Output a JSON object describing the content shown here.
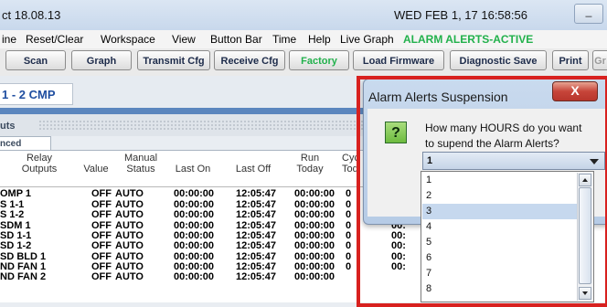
{
  "title_bar": {
    "left_text": "ct 18.08.13",
    "datetime": "WED FEB 1, 17  16:58:56",
    "min_button": "_"
  },
  "menu": {
    "items": [
      "ine",
      "Reset/Clear",
      "Workspace",
      "View",
      "Button Bar",
      "Time",
      "Help",
      "Live Graph"
    ],
    "alarm_status": "ALARM ALERTS-ACTIVE"
  },
  "toolbar": {
    "buttons": [
      "Scan",
      "Graph",
      "Transmit Cfg",
      "Receive Cfg",
      "Factory",
      "Load Firmware",
      "Diagnostic Save",
      "Print",
      "Gr"
    ]
  },
  "tab": {
    "label": "1 - 2 CMP"
  },
  "section": {
    "label": "uts"
  },
  "subtab": {
    "label": "nced"
  },
  "table": {
    "headers": {
      "relay_outputs": "Relay\nOutputs",
      "value": "Value",
      "manual_status": "Manual\nStatus",
      "last_on": "Last On",
      "last_off": "Last Off",
      "run_today": "Run\nToday",
      "cycles_today": "Cyc\nTod"
    },
    "rows": [
      {
        "name": "OMP 1",
        "value": "OFF",
        "status": "AUTO",
        "last_on": "00:00:00",
        "last_off": "12:05:47",
        "run_today": "00:00:00",
        "cycles": "0",
        "extra": ""
      },
      {
        "name": "S 1-1",
        "value": "OFF",
        "status": "AUTO",
        "last_on": "00:00:00",
        "last_off": "12:05:47",
        "run_today": "00:00:00",
        "cycles": "0",
        "extra": ""
      },
      {
        "name": "S 1-2",
        "value": "OFF",
        "status": "AUTO",
        "last_on": "00:00:00",
        "last_off": "12:05:47",
        "run_today": "00:00:00",
        "cycles": "0",
        "extra": ""
      },
      {
        "name": "SDM 1",
        "value": "OFF",
        "status": "AUTO",
        "last_on": "00:00:00",
        "last_off": "12:05:47",
        "run_today": "00:00:00",
        "cycles": "0",
        "extra": "00:"
      },
      {
        "name": "SD 1-1",
        "value": "OFF",
        "status": "AUTO",
        "last_on": "00:00:00",
        "last_off": "12:05:47",
        "run_today": "00:00:00",
        "cycles": "0",
        "extra": "00:"
      },
      {
        "name": "SD 1-2",
        "value": "OFF",
        "status": "AUTO",
        "last_on": "00:00:00",
        "last_off": "12:05:47",
        "run_today": "00:00:00",
        "cycles": "0",
        "extra": "00:"
      },
      {
        "name": "SD BLD 1",
        "value": "OFF",
        "status": "AUTO",
        "last_on": "00:00:00",
        "last_off": "12:05:47",
        "run_today": "00:00:00",
        "cycles": "0",
        "extra": "00:"
      },
      {
        "name": "ND FAN 1",
        "value": "OFF",
        "status": "AUTO",
        "last_on": "00:00:00",
        "last_off": "12:05:47",
        "run_today": "00:00:00",
        "cycles": "0",
        "extra": "00:"
      },
      {
        "name": "ND FAN 2",
        "value": "OFF",
        "status": "AUTO",
        "last_on": "00:00:00",
        "last_off": "12:05:47",
        "run_today": "00:00:00",
        "cycles": "",
        "extra": ""
      }
    ]
  },
  "dialog": {
    "title": "Alarm Alerts Suspension",
    "close": "X",
    "question_icon": "?",
    "question_line1": "How many HOURS do you want",
    "question_line2": "to supend the Alarm Alerts?",
    "selected_value": "1",
    "options": [
      "1",
      "2",
      "3",
      "4",
      "5",
      "6",
      "7",
      "8"
    ]
  },
  "colors": {
    "alarm_green": "#22b14c",
    "highlight_red": "#d8211f",
    "tab_blue": "#1f4ea0"
  }
}
